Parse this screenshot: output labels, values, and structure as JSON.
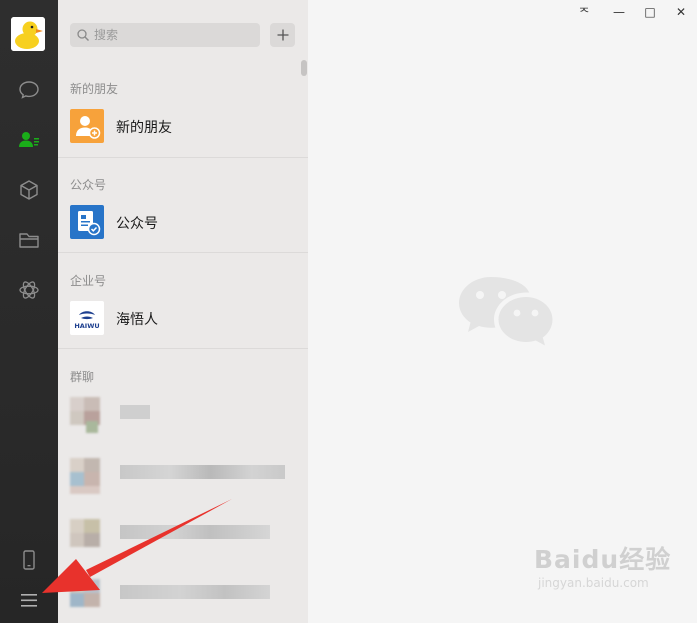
{
  "search": {
    "placeholder": "搜索"
  },
  "sections": {
    "new_friends": {
      "header": "新的朋友",
      "item_label": "新的朋友"
    },
    "official_accounts": {
      "header": "公众号",
      "item_label": "公众号"
    },
    "enterprise": {
      "header": "企业号",
      "item_label": "海悟人",
      "logo_text": "HAIWU"
    },
    "groups": {
      "header": "群聊"
    }
  },
  "window": {
    "pin_glyph": "ᅐ",
    "minimize_glyph": "—",
    "maximize_glyph": "□",
    "close_glyph": "✕"
  },
  "watermark": {
    "main": "Baidu经验",
    "sub": "jingyan.baidu.com"
  },
  "colors": {
    "sidebar": "#2e2e2e",
    "active_nav": "#1aad19",
    "new_friend_icon": "#f7a23b",
    "official_icon": "#2774c8",
    "annotation_arrow": "#e8322c"
  },
  "nav_icons": [
    "chat-icon",
    "contacts-icon",
    "collections-icon",
    "files-icon",
    "moments-icon",
    "phone-icon",
    "menu-icon"
  ]
}
